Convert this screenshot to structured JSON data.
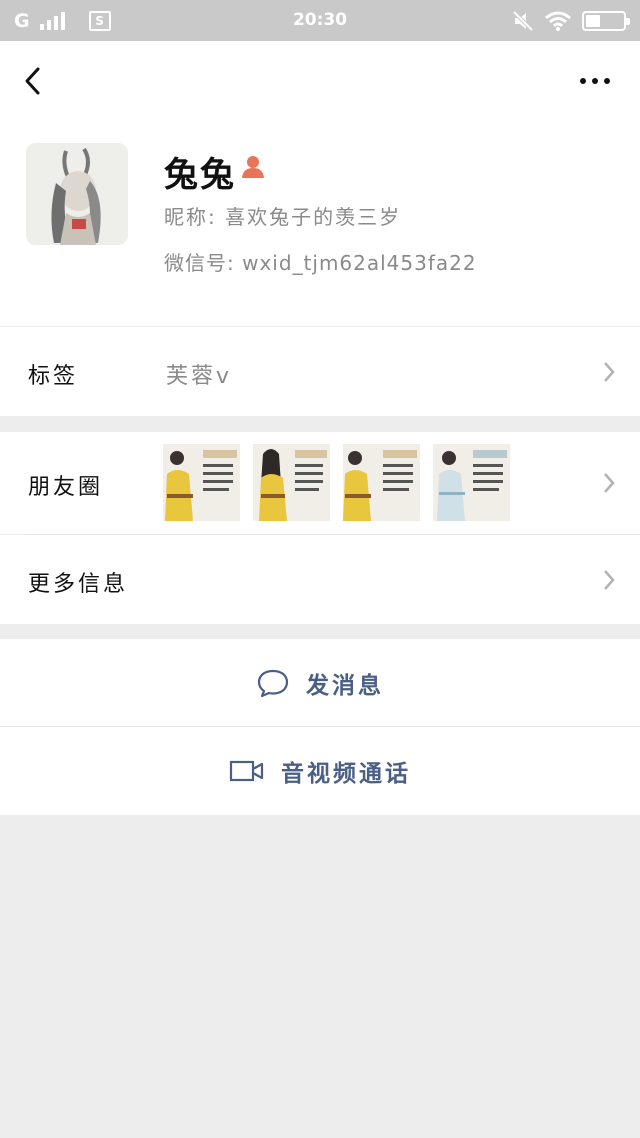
{
  "status_bar": {
    "carrier": "G",
    "sim_icon": "S",
    "time": "20:30",
    "icons": [
      "signal-icon",
      "sim-icon",
      "mute-icon",
      "wifi-icon",
      "battery-icon"
    ]
  },
  "nav": {
    "back_icon": "back-arrow-icon",
    "more_icon": "more-dots-icon"
  },
  "profile": {
    "name": "兔兔",
    "gender_icon": "female-user-icon",
    "nickname": "昵称: 喜欢兔子的羡三岁",
    "wechat_id": "微信号: wxid_tjm62al453fa22"
  },
  "tags_row": {
    "label": "标签",
    "value": "芙蓉v"
  },
  "moments_row": {
    "label": "朋友圈"
  },
  "more_info_row": {
    "label": "更多信息"
  },
  "actions": {
    "message": "发消息",
    "call": "音视频通话"
  },
  "colors": {
    "action_text": "#4a5f86",
    "gender_icon": "#e8755a",
    "background": "#ededed",
    "status_bar": "#c9c9c9"
  }
}
